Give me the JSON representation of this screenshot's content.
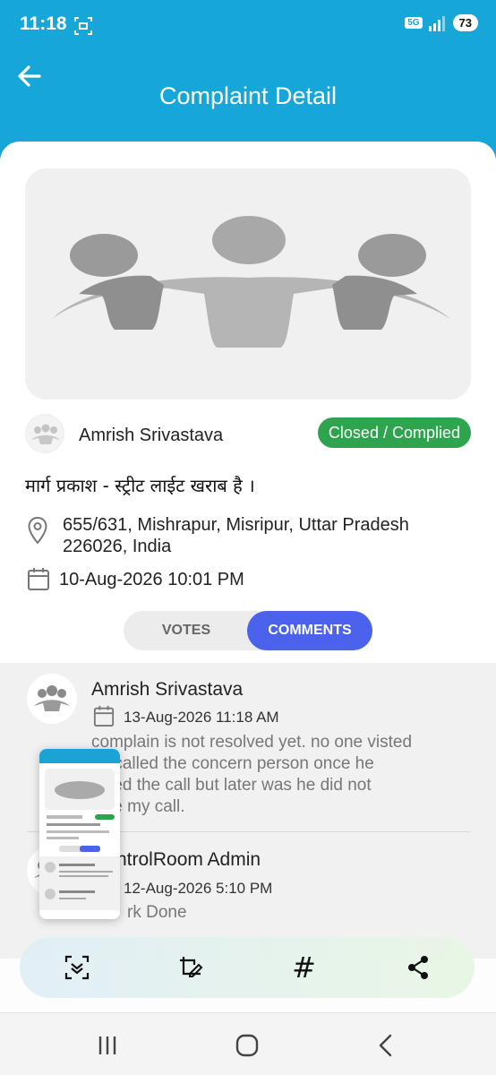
{
  "status_bar": {
    "time": "11:18",
    "network": "5G",
    "battery": "73"
  },
  "header": {
    "title": "Complaint Detail"
  },
  "complaint": {
    "author": "Amrish Srivastava",
    "status": "Closed / Complied",
    "title": "मार्ग प्रकाश - स्ट्रीट लाईट खराब है ।",
    "address": "655/631, Mishrapur, Misripur, Uttar Pradesh 226026, India",
    "date": "10-Aug-2026 10:01 PM"
  },
  "tabs": {
    "votes": "VOTES",
    "comments": "COMMENTS",
    "active": "COMMENTS"
  },
  "comments": [
    {
      "name": "Amrish Srivastava",
      "date": "13-Aug-2026 11:18 AM",
      "text": "complain is not resolved yet. no one visted\nn i called the concern person once he\neived the call but later was he did not\neive my call."
    },
    {
      "name": "ntrolRoom Admin",
      "date": "12-Aug-2026 5:10 PM",
      "text": "rk Done"
    }
  ],
  "toolbar": {
    "hash_label": "#"
  },
  "colors": {
    "header": "#17a6d8",
    "status_pill": "#2ea44f",
    "active_tab": "#4a62ec"
  }
}
